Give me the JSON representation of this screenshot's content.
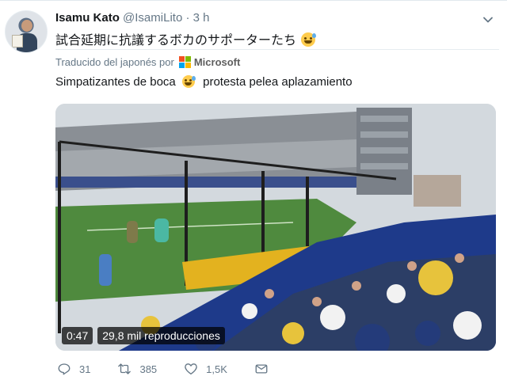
{
  "tweet": {
    "display_name": "Isamu Kato",
    "handle": "@IsamiLito",
    "separator": "·",
    "time": "3 h",
    "text_original": "試合延期に抗議するボカのサポーターたち",
    "translation_label": "Traducido del japonés por",
    "translation_brand": "Microsoft",
    "text_translated_part1": "Simpatizantes de boca",
    "text_translated_part2": "protesta pelea aplazamiento"
  },
  "video": {
    "duration": "0:47",
    "views": "29,8 mil reproducciones"
  },
  "actions": {
    "replies": "31",
    "retweets": "385",
    "likes": "1,5K"
  },
  "colors": {
    "ms_red": "#f25022",
    "ms_green": "#7fba00",
    "ms_blue": "#00a4ef",
    "ms_yellow": "#ffb900",
    "text_secondary": "#657786"
  },
  "icons": [
    "chevron-down-icon",
    "reply-icon",
    "retweet-icon",
    "like-icon",
    "direct-message-icon",
    "grinning-sweat-emoji",
    "microsoft-logo"
  ]
}
